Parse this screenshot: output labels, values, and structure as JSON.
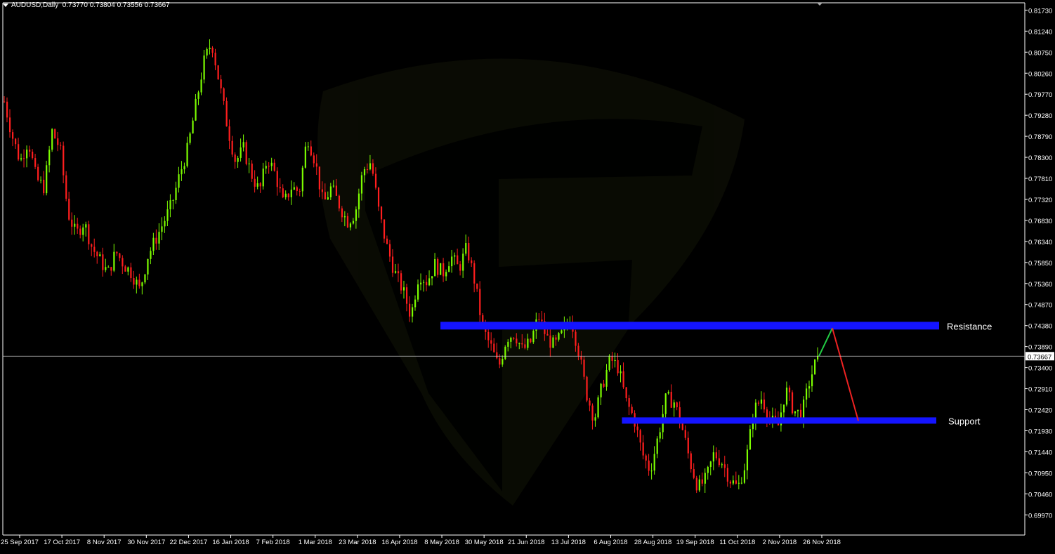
{
  "header": {
    "symbol": "AUDUSD,Daily",
    "ohlc": "0.73770 0.73804 0.73556 0.73667"
  },
  "colors": {
    "background": "#000000",
    "bull": "#7cfc00",
    "bear": "#ff1e1e",
    "zone": "#1414ff",
    "projection_up": "#22cc44",
    "projection_down": "#ee2222",
    "price_line": "#c8c8c8",
    "axis": "#ffffff"
  },
  "chart_data": {
    "type": "candlestick",
    "title": "AUDUSD,Daily",
    "ylim": [
      0.695,
      0.819
    ],
    "y_ticks": [
      "0.81730",
      "0.81240",
      "0.80750",
      "0.80260",
      "0.79770",
      "0.79280",
      "0.78790",
      "0.78300",
      "0.77810",
      "0.77320",
      "0.76830",
      "0.76340",
      "0.75850",
      "0.75360",
      "0.74870",
      "0.74380",
      "0.73890",
      "0.73400",
      "0.72910",
      "0.72420",
      "0.71930",
      "0.71440",
      "0.70950",
      "0.70460",
      "0.69970"
    ],
    "x_ticks": [
      "25 Sep 2017",
      "17 Oct 2017",
      "8 Nov 2017",
      "30 Nov 2017",
      "22 Dec 2017",
      "16 Jan 2018",
      "7 Feb 2018",
      "1 Mar 2018",
      "23 Mar 2018",
      "16 Apr 2018",
      "8 May 2018",
      "30 May 2018",
      "21 Jun 2018",
      "13 Jul 2018",
      "6 Aug 2018",
      "28 Aug 2018",
      "19 Sep 2018",
      "11 Oct 2018",
      "2 Nov 2018",
      "26 Nov 2018"
    ],
    "current_price": "0.73667",
    "current_price_value": 0.73667,
    "close_path": [
      0.796,
      0.788,
      0.782,
      0.787,
      0.778,
      0.776,
      0.789,
      0.785,
      0.77,
      0.765,
      0.768,
      0.762,
      0.759,
      0.756,
      0.761,
      0.758,
      0.756,
      0.752,
      0.76,
      0.764,
      0.768,
      0.772,
      0.779,
      0.785,
      0.795,
      0.805,
      0.81,
      0.8,
      0.79,
      0.782,
      0.785,
      0.779,
      0.775,
      0.783,
      0.779,
      0.772,
      0.776,
      0.775,
      0.788,
      0.782,
      0.772,
      0.776,
      0.772,
      0.768,
      0.77,
      0.78,
      0.782,
      0.77,
      0.762,
      0.756,
      0.752,
      0.746,
      0.756,
      0.754,
      0.758,
      0.756,
      0.76,
      0.757,
      0.762,
      0.754,
      0.743,
      0.739,
      0.734,
      0.741,
      0.742,
      0.738,
      0.74,
      0.746,
      0.741,
      0.739,
      0.742,
      0.746,
      0.738,
      0.728,
      0.722,
      0.73,
      0.736,
      0.734,
      0.726,
      0.722,
      0.714,
      0.71,
      0.718,
      0.727,
      0.726,
      0.72,
      0.712,
      0.706,
      0.708,
      0.714,
      0.712,
      0.708,
      0.706,
      0.712,
      0.724,
      0.727,
      0.722,
      0.72,
      0.729,
      0.724,
      0.723,
      0.731,
      0.7367
    ],
    "resistance": {
      "label": "Resistance",
      "price": 0.7437,
      "start_label": "8 May 2018"
    },
    "support": {
      "label": "Support",
      "price": 0.7216,
      "start_label": "6 Aug 2018"
    },
    "projection": [
      0.7367,
      0.7432,
      0.7216
    ]
  }
}
